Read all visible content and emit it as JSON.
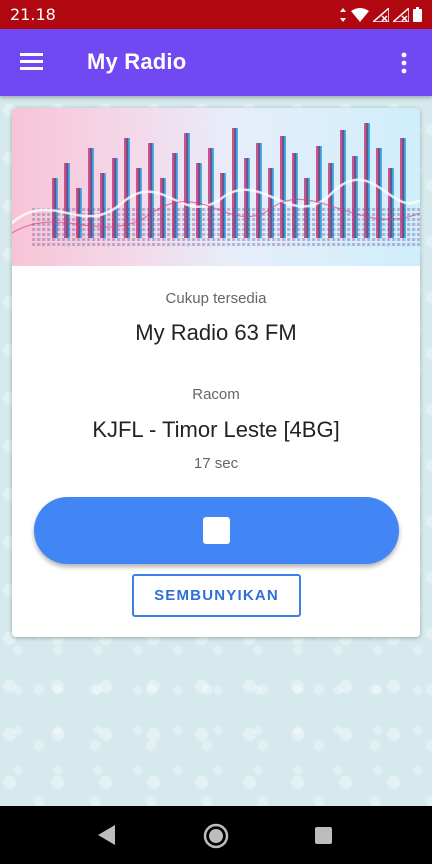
{
  "status_bar": {
    "time": "21.18"
  },
  "app_bar": {
    "title": "My Radio"
  },
  "player": {
    "status_label": "Cukup tersedia",
    "station_name": "My Radio 63 FM",
    "artist_label": "Racom",
    "track_title": "KJFL - Timor Leste [4BG]",
    "elapsed": "17 sec",
    "hide_button_label": "SEMBUNYIKAN"
  },
  "colors": {
    "status_bar": "#b00710",
    "app_bar": "#7049f2",
    "play_button": "#4285f4",
    "hide_button_border": "#3d7fe6"
  },
  "icons": {
    "menu": "hamburger-menu-icon",
    "overflow": "more-vert-icon",
    "stop": "stop-icon",
    "nav_back": "triangle-back-icon",
    "nav_home": "circle-home-icon",
    "nav_recents": "square-recents-icon"
  }
}
